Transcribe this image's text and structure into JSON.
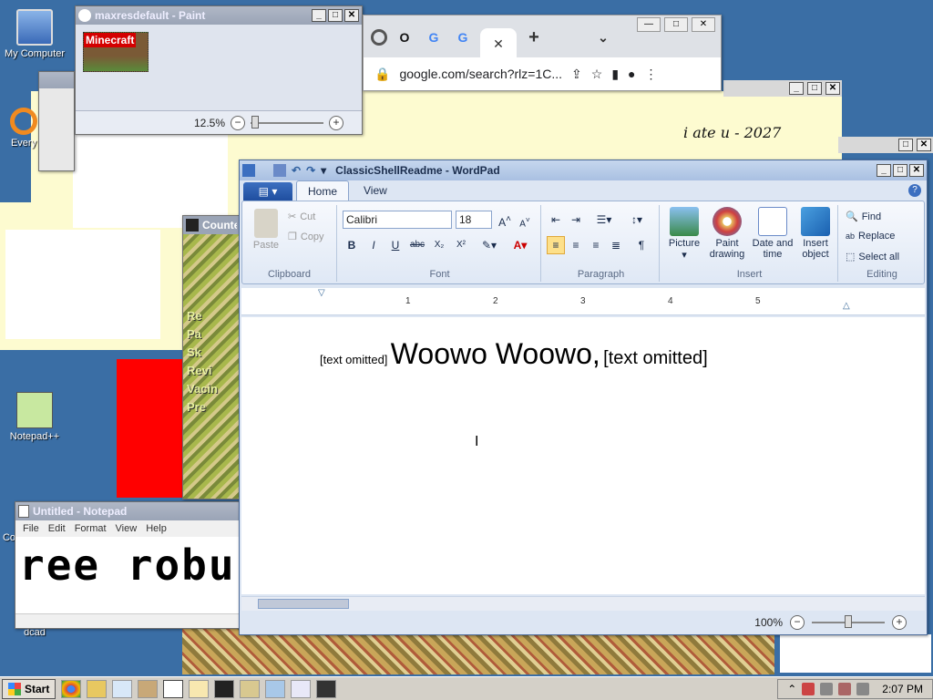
{
  "desktop": {
    "icons": [
      {
        "label": "My Computer"
      },
      {
        "label": "Every"
      },
      {
        "label": "Notepad++"
      },
      {
        "label": "Co"
      },
      {
        "label": "dcad"
      }
    ]
  },
  "paint": {
    "title": "maxresdefault - Paint",
    "canvas_label": "Minecraft",
    "zoom": "12.5%",
    "zoom_level_fraction": 0.02
  },
  "chrome": {
    "address": "google.com/search?rlz=1C..."
  },
  "background": {
    "handwritten_text": "i ate u - 2027"
  },
  "counter": {
    "title": "Counte",
    "lines": [
      "Re",
      "Pa",
      "Sk",
      "Revi",
      "Vacin",
      "Pre"
    ]
  },
  "notepad": {
    "title": "Untitled - Notepad",
    "menu": [
      "File",
      "Edit",
      "Format",
      "View",
      "Help"
    ],
    "content": "ree robu"
  },
  "wordpad": {
    "title": "ClassicShellReadme - WordPad",
    "tabs": [
      "Home",
      "View"
    ],
    "clipboard": {
      "paste": "Paste",
      "cut": "Cut",
      "copy": "Copy",
      "group": "Clipboard"
    },
    "font": {
      "family": "Calibri",
      "size": "18",
      "group": "Font",
      "bold": "B",
      "italic": "I",
      "underline": "U",
      "strike": "abc",
      "sub": "X₂",
      "sup": "X²"
    },
    "paragraph": {
      "group": "Paragraph"
    },
    "insert": {
      "picture": "Picture",
      "paint_drawing": "Paint drawing",
      "date_time": "Date and time",
      "insert_object": "Insert object",
      "group": "Insert"
    },
    "editing": {
      "find": "Find",
      "replace": "Replace",
      "select_all": "Select all",
      "group": "Editing"
    },
    "ruler_marks": [
      "1",
      "2",
      "3",
      "4",
      "5"
    ],
    "doc": {
      "small_a": "[text omitted]",
      "large": "Woowo Woowo,",
      "small_b": "[text omitted]"
    },
    "zoom": "100%",
    "zoom_level_fraction": 0.5
  },
  "taskbar": {
    "start": "Start",
    "clock": "2:07 PM"
  }
}
